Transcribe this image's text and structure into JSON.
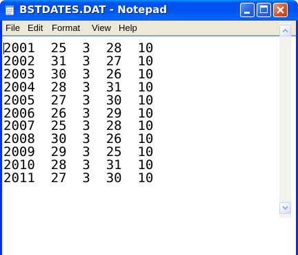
{
  "window": {
    "title": "BSTDATES.DAT - Notepad",
    "icon": "notepad-icon",
    "controls": {
      "minimize_icon": "minimize-icon",
      "maximize_icon": "maximize-icon",
      "close_icon": "close-icon"
    },
    "colors": {
      "titlebar": "#0054e3",
      "close_button": "#e0502a",
      "menubar": "#ece9d8"
    }
  },
  "menu": {
    "file": "File",
    "edit": "Edit",
    "format": "Format",
    "view": "View",
    "help": "Help"
  },
  "document": {
    "content": "2001  25  3  28  10\n2002  31  3  27  10\n2003  30  3  26  10\n2004  28  3  31  10\n2005  27  3  30  10\n2006  26  3  29  10\n2007  25  3  28  10\n2008  30  3  26  10\n2009  29  3  25  10\n2010  28  3  31  10\n2011  27  3  30  10"
  },
  "scrollbar": {
    "up_icon": "scroll-up-arrow-icon",
    "down_icon": "scroll-down-arrow-icon"
  }
}
